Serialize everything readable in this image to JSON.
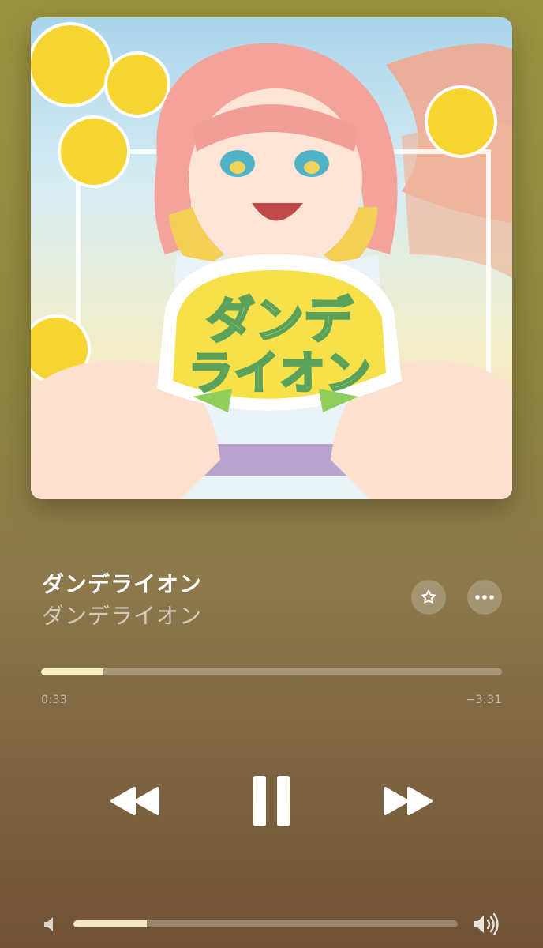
{
  "player": {
    "artwork": {
      "logo_text": "ダンデライオン",
      "line1": "ダンデ",
      "line2": "ライオン"
    },
    "track_title": "ダンデライオン",
    "artist_name": "ダンデライオン",
    "buttons": {
      "favorite_icon": "star-icon",
      "more_icon": "ellipsis-icon",
      "rewind_icon": "backward-icon",
      "pause_icon": "pause-icon",
      "forward_icon": "forward-icon"
    },
    "progress": {
      "elapsed": "0:33",
      "remaining": "−3:31",
      "fraction": 0.135
    },
    "volume": {
      "low_icon": "speaker-low-icon",
      "high_icon": "speaker-high-icon",
      "fraction": 0.19
    },
    "colors": {
      "background_top": "#9a9340",
      "background_bottom": "#6f5234",
      "progress_fill": "#f6ecc6"
    }
  }
}
